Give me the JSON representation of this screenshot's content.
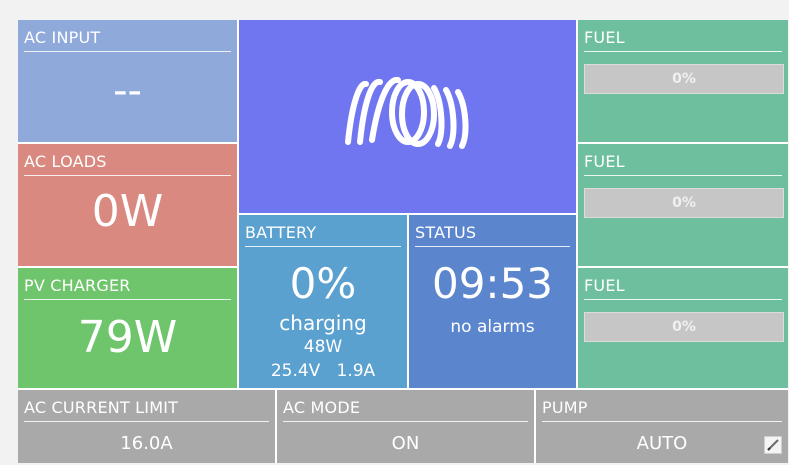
{
  "ac_input": {
    "title": "AC INPUT",
    "value": "--"
  },
  "ac_loads": {
    "title": "AC LOADS",
    "value": "0W"
  },
  "pv_charger": {
    "title": "PV CHARGER",
    "value": "79W"
  },
  "logo": {
    "icon": "victron-logo-icon"
  },
  "battery": {
    "title": "BATTERY",
    "soc": "0%",
    "state": "charging",
    "power": "48W",
    "voltage": "25.4V",
    "current": "1.9A"
  },
  "status": {
    "title": "STATUS",
    "time": "09:53",
    "alarms": "no alarms"
  },
  "fuel": [
    {
      "title": "FUEL",
      "level_label": "0%",
      "level": 0
    },
    {
      "title": "FUEL",
      "level_label": "0%",
      "level": 0
    },
    {
      "title": "FUEL",
      "level_label": "0%",
      "level": 0
    }
  ],
  "ac_current_limit": {
    "title": "AC CURRENT LIMIT",
    "value": "16.0A"
  },
  "ac_mode": {
    "title": "AC MODE",
    "value": "ON"
  },
  "pump": {
    "title": "PUMP",
    "value": "AUTO",
    "icon": "edit-icon"
  },
  "colors": {
    "ac_input": "#8fa9db",
    "ac_loads": "#d9897f",
    "pv_charger": "#6ec56b",
    "logo": "#6f76ef",
    "battery": "#5ba1cf",
    "status": "#5b86ce",
    "fuel": "#6dbf9d",
    "bottom": "#a9a9a9"
  }
}
